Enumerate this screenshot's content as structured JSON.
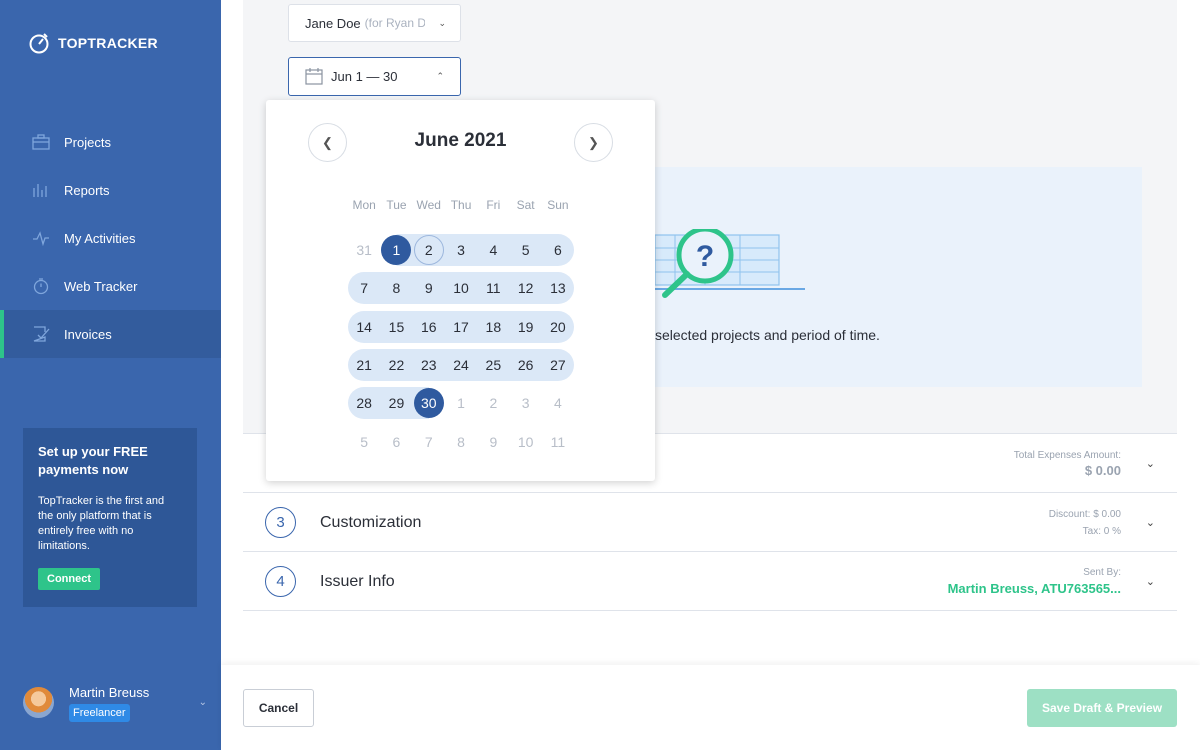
{
  "app": {
    "logo_text": "TOPTRACKER"
  },
  "sidebar": {
    "items": [
      {
        "label": "Projects",
        "icon": "briefcase-icon"
      },
      {
        "label": "Reports",
        "icon": "bar-chart-icon"
      },
      {
        "label": "My Activities",
        "icon": "activity-icon"
      },
      {
        "label": "Web Tracker",
        "icon": "stopwatch-icon"
      },
      {
        "label": "Invoices",
        "icon": "invoice-icon",
        "active": true
      }
    ],
    "promo": {
      "title": "Set up your FREE payments now",
      "body": "TopTracker is the first and the only platform that is entirely free with no limitations.",
      "button": "Connect"
    },
    "user": {
      "name": "Martin Breuss",
      "role": "Freelancer"
    }
  },
  "filters": {
    "client": "Jane Doe",
    "client_sub": "(for Ryan D",
    "date_range": "Jun 1 — 30"
  },
  "calendar": {
    "title": "June 2021",
    "weekdays": [
      "Mon",
      "Tue",
      "Wed",
      "Thu",
      "Fri",
      "Sat",
      "Sun"
    ],
    "rows": [
      [
        "31",
        "1",
        "2",
        "3",
        "4",
        "5",
        "6"
      ],
      [
        "7",
        "8",
        "9",
        "10",
        "11",
        "12",
        "13"
      ],
      [
        "14",
        "15",
        "16",
        "17",
        "18",
        "19",
        "20"
      ],
      [
        "21",
        "22",
        "23",
        "24",
        "25",
        "26",
        "27"
      ],
      [
        "28",
        "29",
        "30",
        "1",
        "2",
        "3",
        "4"
      ],
      [
        "5",
        "6",
        "7",
        "8",
        "9",
        "10",
        "11"
      ]
    ]
  },
  "empty_state": {
    "text": "selected projects and period of time."
  },
  "sections": {
    "expenses": {
      "label": "Total Expenses Amount:",
      "value": "$ 0.00"
    },
    "customization": {
      "step": "3",
      "title": "Customization",
      "discount_label": "Discount:",
      "discount_value": "$ 0.00",
      "tax_label": "Tax:",
      "tax_value": "0 %"
    },
    "issuer": {
      "step": "4",
      "title": "Issuer Info",
      "sent_by_label": "Sent By:",
      "sent_by_value": "Martin Breuss, ATU763565..."
    }
  },
  "footer": {
    "cancel": "Cancel",
    "save": "Save Draft & Preview"
  },
  "colors": {
    "sidebar": "#3a66ad",
    "accent_green": "#2ec48a",
    "selected_day": "#2f5a9f",
    "range": "#dbe8f7"
  }
}
